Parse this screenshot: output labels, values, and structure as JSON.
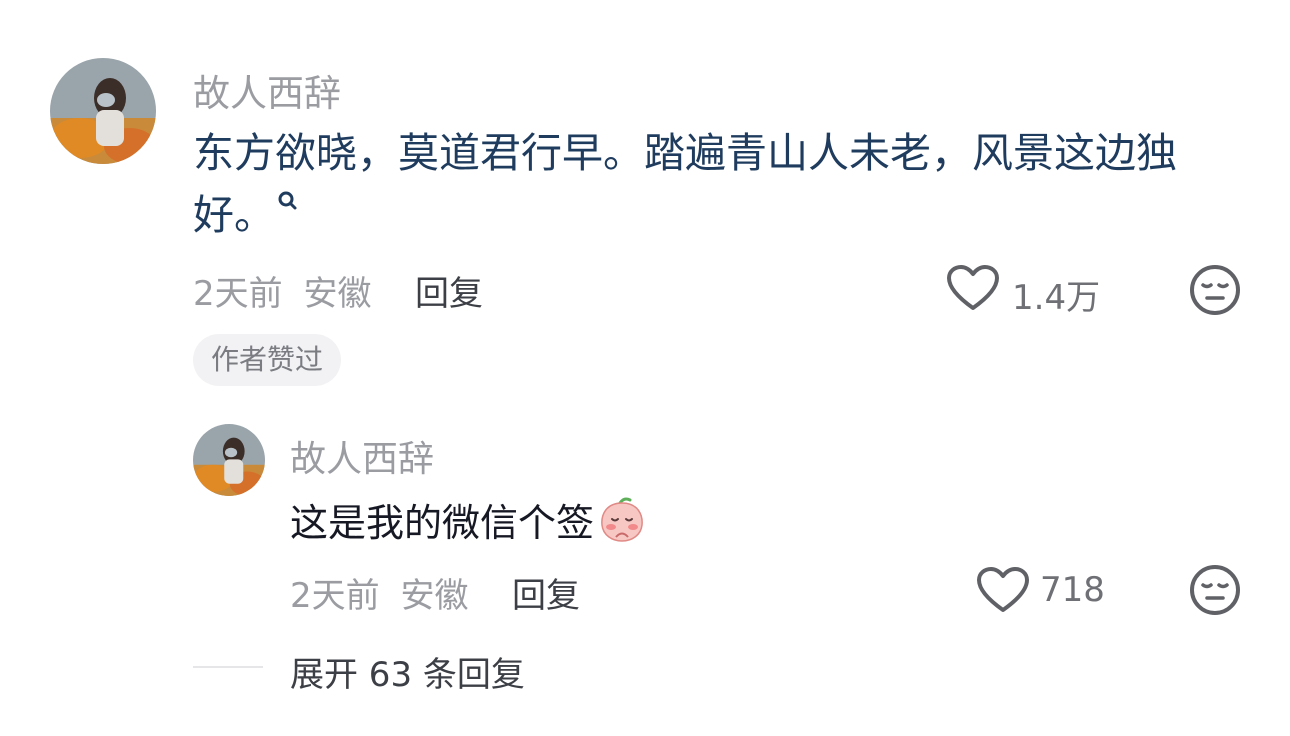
{
  "comment": {
    "username": "故人西辞",
    "text_line1": "东方欲晓，莫道君行早。踏遍青山人未老，风景这边独",
    "text_line2": "好。",
    "time": "2天前",
    "location": "安徽",
    "reply_label": "回复",
    "like_count": "1.4万",
    "author_badge": "作者赞过"
  },
  "reply": {
    "username": "故人西辞",
    "text": "这是我的微信个签",
    "time": "2天前",
    "location": "安徽",
    "reply_label": "回复",
    "like_count": "718"
  },
  "expand": {
    "label": "展开 63 条回复"
  },
  "icons": {
    "like": "heart-outline-icon",
    "dislike": "meh-face-icon",
    "search": "search-icon",
    "emoji": "shy-peach-emoji"
  },
  "colors": {
    "comment_text": "#1f3c5f",
    "meta_gray": "#9a9ca2",
    "icon_gray": "#5f6166"
  }
}
